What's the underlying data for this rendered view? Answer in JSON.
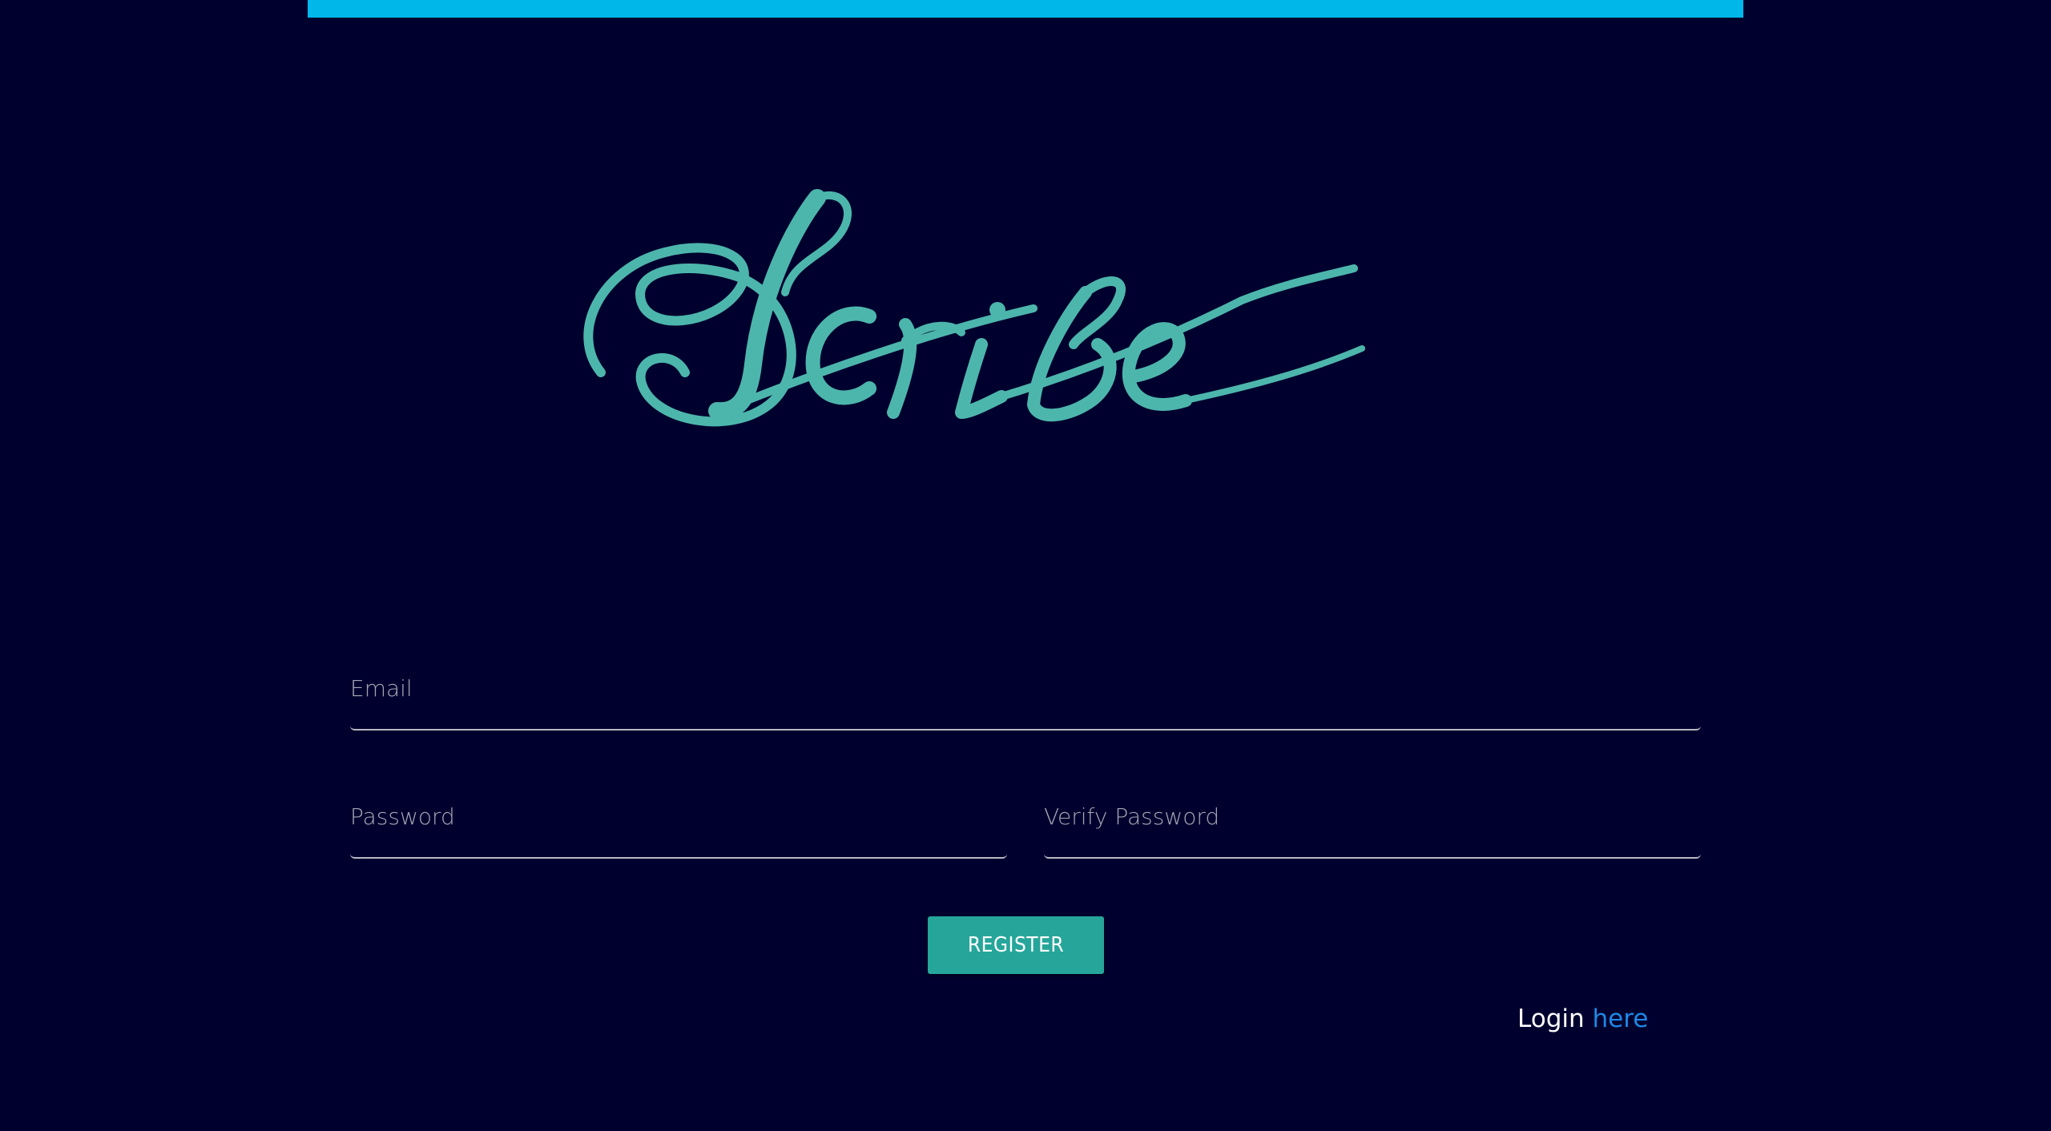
{
  "brand": {
    "logo_text": "Scribe",
    "logo_color": "#4db6ac"
  },
  "colors": {
    "background": "#00002e",
    "top_accent": "#00b7ea",
    "button": "#26a69a",
    "link": "#1e88e5"
  },
  "form": {
    "email_placeholder": "Email",
    "password_placeholder": "Password",
    "verify_password_placeholder": "Verify Password",
    "register_label": "REGISTER"
  },
  "footer": {
    "login_prefix": "Login ",
    "login_link": "here"
  }
}
